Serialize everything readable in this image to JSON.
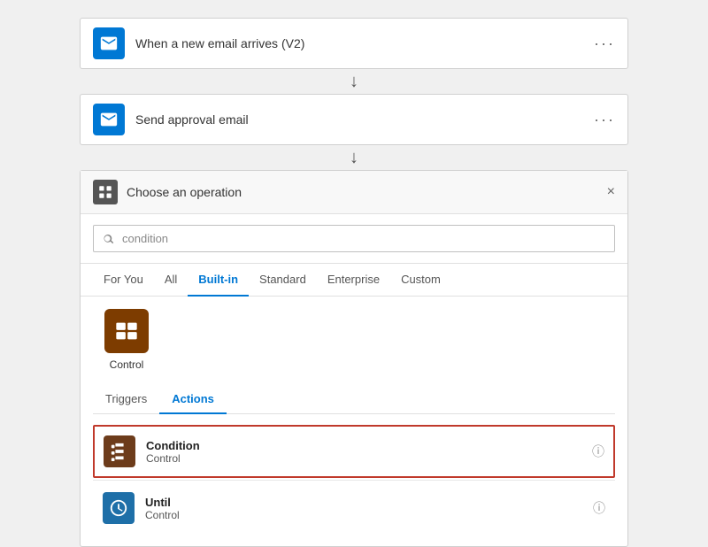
{
  "flow": {
    "step1": {
      "label": "When a new email arrives (V2)",
      "dots": "···"
    },
    "step2": {
      "label": "Send approval email",
      "dots": "···"
    }
  },
  "panel": {
    "title": "Choose an operation",
    "close": "×"
  },
  "search": {
    "placeholder": "condition",
    "value": "condition"
  },
  "tabs": [
    {
      "id": "for-you",
      "label": "For You",
      "active": false
    },
    {
      "id": "all",
      "label": "All",
      "active": false
    },
    {
      "id": "built-in",
      "label": "Built-in",
      "active": true
    },
    {
      "id": "standard",
      "label": "Standard",
      "active": false
    },
    {
      "id": "enterprise",
      "label": "Enterprise",
      "active": false
    },
    {
      "id": "custom",
      "label": "Custom",
      "active": false
    }
  ],
  "connectors": [
    {
      "id": "control",
      "label": "Control"
    }
  ],
  "sub_tabs": [
    {
      "id": "triggers",
      "label": "Triggers",
      "active": false
    },
    {
      "id": "actions",
      "label": "Actions",
      "active": true
    }
  ],
  "actions": [
    {
      "id": "condition",
      "name": "Condition",
      "sub": "Control",
      "selected": true,
      "info": "ⓘ"
    },
    {
      "id": "until",
      "name": "Until",
      "sub": "Control",
      "selected": false,
      "info": "ⓘ"
    }
  ],
  "icons": {
    "email": "✉",
    "operation": "⊞",
    "control_card": "⊞",
    "condition_action": "⊞",
    "until_action": "⊞"
  }
}
